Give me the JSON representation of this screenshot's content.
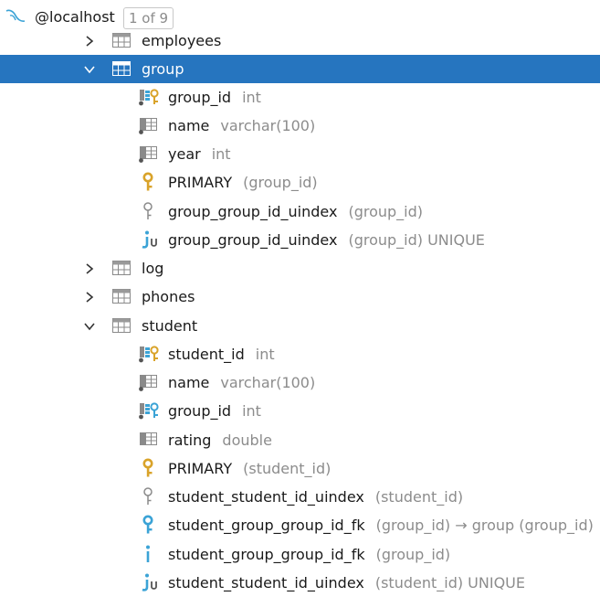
{
  "root": {
    "name": "@localhost",
    "badge": "1 of 9"
  },
  "nodes": [
    {
      "label": "employees",
      "detail": ""
    },
    {
      "label": "group",
      "detail": ""
    },
    {
      "label": "group_id",
      "detail": "int"
    },
    {
      "label": "name",
      "detail": "varchar(100)"
    },
    {
      "label": "year",
      "detail": "int"
    },
    {
      "label": "PRIMARY",
      "detail": "(group_id)"
    },
    {
      "label": "group_group_id_uindex",
      "detail": "(group_id)"
    },
    {
      "label": "group_group_id_uindex",
      "detail": "(group_id) UNIQUE"
    },
    {
      "label": "log",
      "detail": ""
    },
    {
      "label": "phones",
      "detail": ""
    },
    {
      "label": "student",
      "detail": ""
    },
    {
      "label": "student_id",
      "detail": "int"
    },
    {
      "label": "name",
      "detail": "varchar(100)"
    },
    {
      "label": "group_id",
      "detail": "int"
    },
    {
      "label": "rating",
      "detail": "double"
    },
    {
      "label": "PRIMARY",
      "detail": "(student_id)"
    },
    {
      "label": "student_student_id_uindex",
      "detail": "(student_id)"
    },
    {
      "label": "student_group_group_id_fk",
      "detail": "(group_id) → group (group_id)"
    },
    {
      "label": "student_group_group_id_fk",
      "detail": "(group_id)"
    },
    {
      "label": "student_student_id_uindex",
      "detail": "(student_id) UNIQUE"
    }
  ],
  "colors": {
    "selection": "#2675bf",
    "key": "#d9a32a",
    "foreign_key": "#3ba3d6",
    "detail_text": "#8c8c8c"
  },
  "icons": {
    "root": "datasource-icon",
    "table": "table-icon",
    "pk_column": "primary-key-column-icon",
    "column": "column-icon",
    "fk_column": "foreign-key-column-icon",
    "primary_key": "key-icon",
    "index": "index-icon",
    "unique_index": "unique-index-icon",
    "foreign_key": "foreign-key-icon"
  }
}
